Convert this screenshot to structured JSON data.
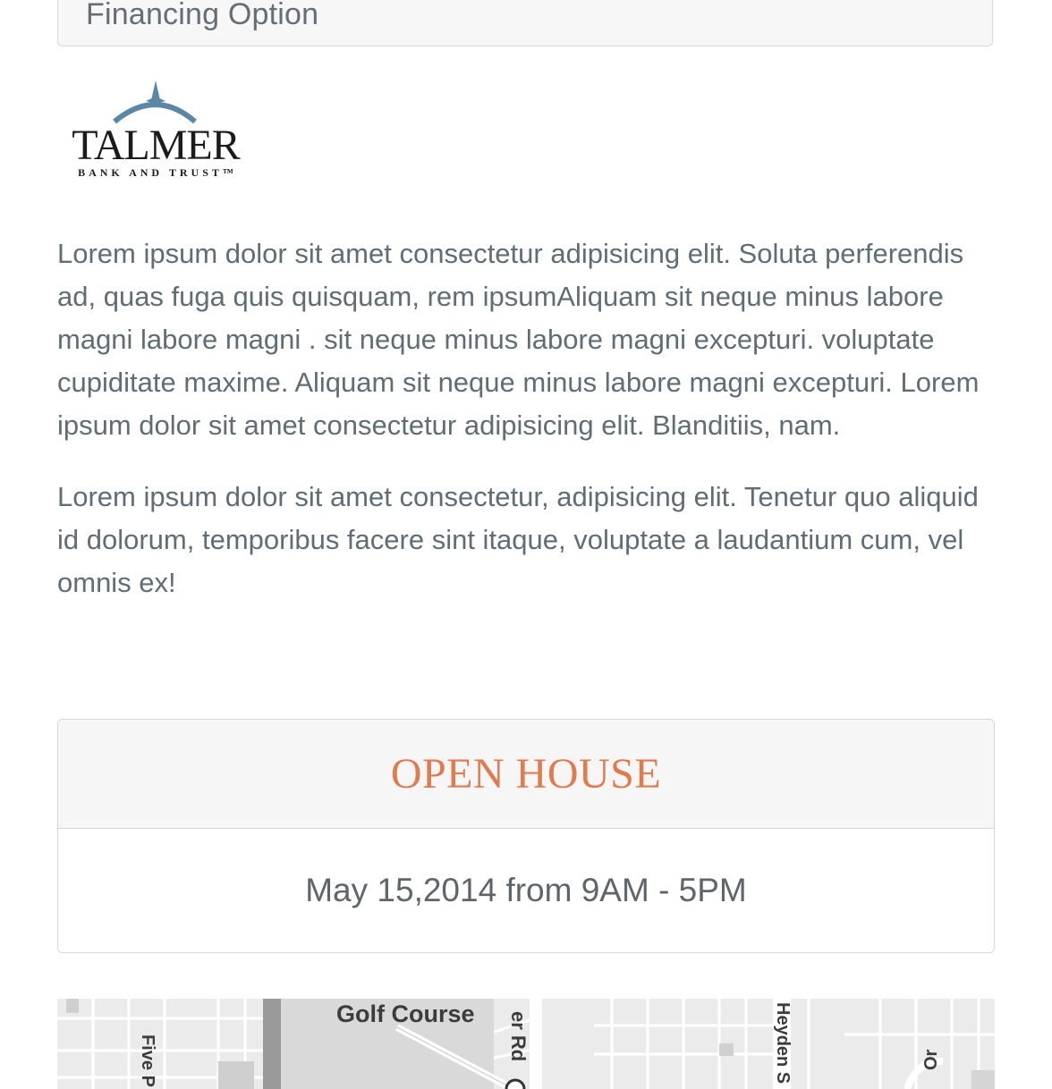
{
  "financing": {
    "title": "Financing Option"
  },
  "logo": {
    "name": "TALMER",
    "tagline": "BANK AND TRUST™"
  },
  "content": {
    "paragraphs": [
      "Lorem ipsum dolor sit amet consectetur adipisicing elit. Soluta perferendis ad, quas fuga quis quisquam, rem ipsumAliquam sit neque minus labore magni labore magni . sit neque minus labore magni excepturi. voluptate cupiditate maxime. Aliquam sit neque minus labore magni excepturi. Lorem ipsum dolor sit amet consectetur adipisicing elit. Blanditiis, nam.",
      "Lorem ipsum dolor sit amet consectetur, adipisicing elit. Tenetur quo aliquid id dolorum, temporibus facere sint itaque, voluptate a laudantium cum, vel omnis ex!"
    ]
  },
  "open_house": {
    "title": "OPEN HOUSE",
    "date_text": "May 15,2014 from 9AM - 5PM"
  },
  "map": {
    "labels": {
      "golf_course": "Golf Course",
      "road_1": "er Rd",
      "road_2": "Five P",
      "road_3": "Heyden S",
      "road_4": "Or"
    }
  },
  "colors": {
    "accent": "#e07a4f",
    "text": "#5f6d75",
    "panel_bg": "#f6f6f6",
    "border": "#d6d6d6",
    "logo_blue": "#5b87a7"
  }
}
